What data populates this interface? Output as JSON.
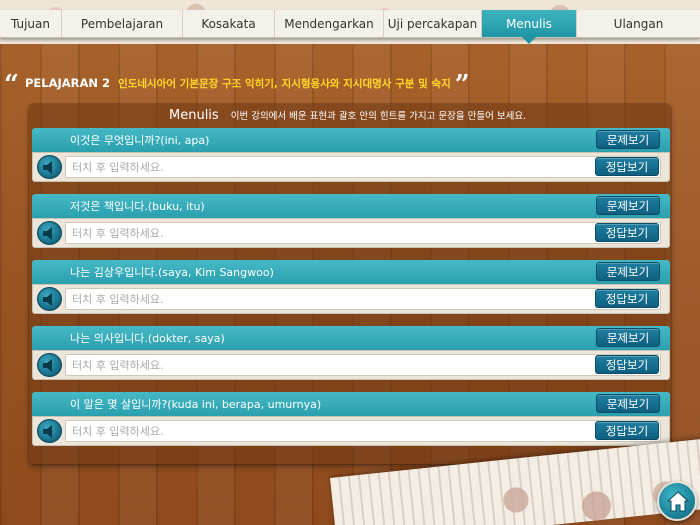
{
  "nav": {
    "tabs": [
      {
        "label": "Tujuan"
      },
      {
        "label": "Pembelajaran"
      },
      {
        "label": "Kosakata"
      },
      {
        "label": "Mendengarkan"
      },
      {
        "label": "Uji percakapan"
      },
      {
        "label": "Menulis"
      },
      {
        "label": "Ulangan"
      }
    ],
    "active": "Menulis"
  },
  "lesson": {
    "number_label": "PELAJARAN 2",
    "title": "인도네시아어 기본문장 구조 익히기, 지시형용사와 지시대명사 구분 및 숙지"
  },
  "panel": {
    "title": "Menulis",
    "description": "이번 강의에서 배운 표현과 괄호 안의 힌트를 가지고 문장을 만들어 보세요."
  },
  "buttons": {
    "show_question": "문제보기",
    "show_answer": "정답보기"
  },
  "answer_placeholder": "터치 후 입력하세요.",
  "items": [
    {
      "question": "이것은 무엇입니까?(ini, apa)",
      "answer": ""
    },
    {
      "question": "저것은 책입니다.(buku, itu)",
      "answer": ""
    },
    {
      "question": "나는 김상우입니다.(saya, Kim Sangwoo)",
      "answer": ""
    },
    {
      "question": "나는 의사입니다.(dokter, saya)",
      "answer": ""
    },
    {
      "question": "이 말은 몇 살입니까?(kuda ini, berapa, umurnya)",
      "answer": ""
    }
  ],
  "colors": {
    "accent": "#2a9fae",
    "button": "#0f5f80",
    "lesson_title": "#ffd92a"
  },
  "icons": {
    "speaker": "speaker-icon",
    "home": "home-icon"
  }
}
